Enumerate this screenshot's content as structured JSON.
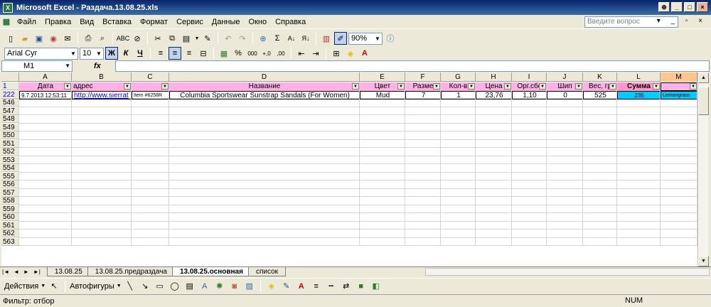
{
  "window": {
    "title": "Microsoft Excel - Раздача.13.08.25.xls",
    "app_icon": "X"
  },
  "menu": {
    "items": [
      "Файл",
      "Правка",
      "Вид",
      "Вставка",
      "Формат",
      "Сервис",
      "Данные",
      "Окно",
      "Справка"
    ],
    "help_placeholder": "Введите вопрос"
  },
  "standard_toolbar": {
    "zoom": "90%"
  },
  "format_toolbar": {
    "font": "Arial Cyr",
    "size": "10",
    "bold": "Ж",
    "italic": "К",
    "underline": "Ч",
    "percent": "%",
    "thousands": "000"
  },
  "formula_bar": {
    "name_box": "M1",
    "fx": "fx",
    "content": ""
  },
  "columns": [
    "A",
    "B",
    "C",
    "D",
    "E",
    "F",
    "G",
    "H",
    "I",
    "J",
    "K",
    "L",
    "M"
  ],
  "header_row": {
    "row_num": "1",
    "cells": [
      "Дата",
      "адрес",
      "",
      "Название",
      "Цвет",
      "Разме",
      "Кол-в",
      "Цена",
      "Орг.сбс",
      "Шип",
      "Вес, гр",
      "Сумма",
      ""
    ]
  },
  "data_row": {
    "row_num": "222",
    "cells": [
      "9.7.2013 12:53:11",
      "http://www.sierrat",
      "Item #6258R",
      "Columbia Sportswear Sunstrap Sandals (For Women)",
      "Mud",
      "7",
      "1",
      "23,76",
      "1,10",
      "0",
      "525",
      "235",
      "Lemongrass"
    ]
  },
  "empty_rows": [
    "546",
    "547",
    "548",
    "549",
    "550",
    "551",
    "552",
    "553",
    "554",
    "555",
    "556",
    "557",
    "558",
    "559",
    "560",
    "561",
    "562",
    "563"
  ],
  "sheet_tabs": [
    {
      "label": "13.08.25",
      "active": false
    },
    {
      "label": "13.08.25.предраздача",
      "active": false
    },
    {
      "label": "13.08.25.основная",
      "active": true
    },
    {
      "label": "список",
      "active": false
    }
  ],
  "drawing_toolbar": {
    "actions": "Действия",
    "autoshapes": "Автофигуры"
  },
  "status": {
    "left": "Фильтр: отбор",
    "num": "NUM"
  },
  "colors": {
    "header_fill": "#FFB2E3",
    "summa_fill": "#FF99CC",
    "cyan_cell": "#00CCFF",
    "title_start": "#0A246A"
  }
}
